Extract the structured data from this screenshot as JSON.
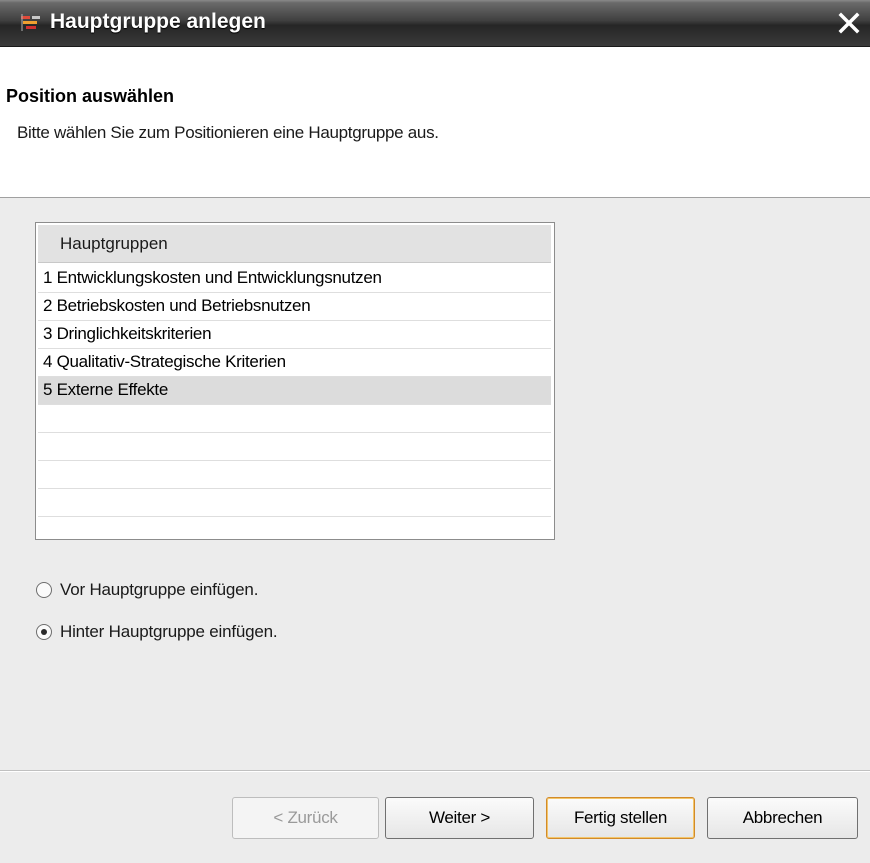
{
  "window": {
    "title": "Hauptgruppe anlegen",
    "app_icon": "app-logo-icon",
    "close_icon": "close-icon"
  },
  "header": {
    "title": "Position auswählen",
    "description": "Bitte wählen Sie zum Positionieren eine Hauptgruppe aus."
  },
  "list": {
    "column_header": "Hauptgruppen",
    "items": [
      "1 Entwicklungskosten und Entwicklungsnutzen",
      "2 Betriebskosten und Betriebsnutzen",
      "3 Dringlichkeitskriterien",
      "4 Qualitativ-Strategische Kriterien",
      "5 Externe Effekte"
    ],
    "selected_item": "5 Externe Effekte"
  },
  "options": {
    "before_label": "Vor Hauptgruppe einfügen.",
    "after_label": "Hinter Hauptgruppe einfügen.",
    "selected": "after"
  },
  "buttons": {
    "back": "< Zurück",
    "next": "Weiter >",
    "finish": "Fertig stellen",
    "cancel": "Abbrechen"
  },
  "colors": {
    "titlebar": "#262626",
    "content_bg": "#ececec",
    "selected_row": "#dcdcdc",
    "default_button_border": "#d28a2a"
  }
}
